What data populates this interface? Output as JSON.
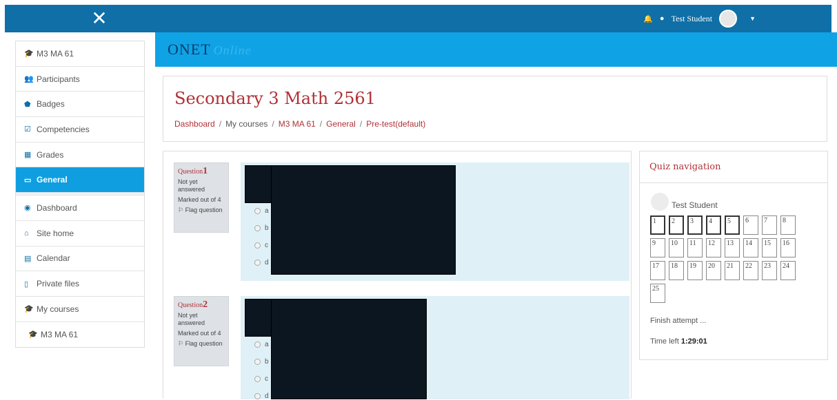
{
  "topbar": {
    "close_glyph": "✕",
    "bell_icon": "🔔",
    "chat_icon": "●",
    "username": "Test Student",
    "caret": "▼"
  },
  "sidebar": {
    "items": [
      {
        "label": "M3 MA 61",
        "icon": "graduation-cap-icon",
        "glyph": "🎓"
      },
      {
        "label": "Participants",
        "icon": "users-icon",
        "glyph": "👥"
      },
      {
        "label": "Badges",
        "icon": "shield-icon",
        "glyph": "⬟"
      },
      {
        "label": "Competencies",
        "icon": "checkbox-icon",
        "glyph": "☑"
      },
      {
        "label": "Grades",
        "icon": "table-icon",
        "glyph": "▦"
      },
      {
        "label": "General",
        "icon": "folder-icon",
        "glyph": "▭"
      },
      {
        "label": "Dashboard",
        "icon": "dashboard-icon",
        "glyph": "◉"
      },
      {
        "label": "Site home",
        "icon": "home-icon",
        "glyph": "⌂"
      },
      {
        "label": "Calendar",
        "icon": "calendar-icon",
        "glyph": "▤"
      },
      {
        "label": "Private files",
        "icon": "file-icon",
        "glyph": "▯"
      },
      {
        "label": "My courses",
        "icon": "graduation-cap-icon",
        "glyph": "🎓"
      },
      {
        "label": "M3 MA 61",
        "icon": "graduation-cap-icon",
        "glyph": "🎓"
      }
    ]
  },
  "banner": {
    "logo_main": "ONET",
    "logo_sub": "Online"
  },
  "header": {
    "title": "Secondary 3 Math 2561",
    "breadcrumb": [
      "Dashboard",
      "My courses",
      "M3 MA 61",
      "General",
      "Pre-test(default)"
    ]
  },
  "questions": [
    {
      "label": "Question",
      "number": "1",
      "status": "Not yet answered",
      "marks": "Marked out of 4",
      "flag": "Flag question",
      "options": [
        "a",
        "b",
        "c",
        "d"
      ]
    },
    {
      "label": "Question",
      "number": "2",
      "status": "Not yet answered",
      "marks": "Marked out of 4",
      "flag": "Flag question",
      "options": [
        "a",
        "b",
        "c",
        "d"
      ]
    }
  ],
  "quiz_nav": {
    "title": "Quiz navigation",
    "student": "Test Student",
    "questions": [
      "1",
      "2",
      "3",
      "4",
      "5",
      "6",
      "7",
      "8",
      "9",
      "10",
      "11",
      "12",
      "13",
      "14",
      "15",
      "16",
      "17",
      "18",
      "19",
      "20",
      "21",
      "22",
      "23",
      "24",
      "25"
    ],
    "finish": "Finish attempt ...",
    "time_label": "Time left",
    "time_value": "1:29:01"
  }
}
